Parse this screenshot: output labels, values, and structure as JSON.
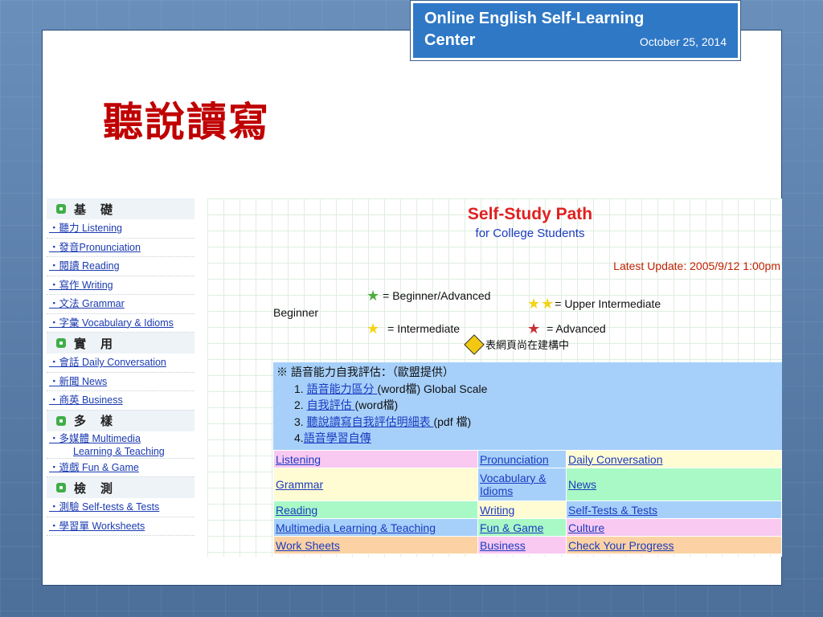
{
  "header": {
    "title": "Online English Self-Learning Center",
    "date": "October 25, 2014"
  },
  "slide_title": "聽說讀寫",
  "nav": {
    "sections": [
      {
        "heading": "基礎",
        "items": [
          {
            "label": "‧聽力 Listening"
          },
          {
            "label": "‧發音Pronunciation"
          },
          {
            "label": "‧閱讀 Reading"
          },
          {
            "label": "‧寫作 Writing"
          },
          {
            "label": "‧文法 Grammar"
          },
          {
            "label": "‧字彙 Vocabulary & Idioms"
          }
        ]
      },
      {
        "heading": "實用",
        "items": [
          {
            "label": "‧會話 Daily Conversation"
          },
          {
            "label": "‧新聞 News"
          },
          {
            "label": "‧商英 Business"
          }
        ]
      },
      {
        "heading": "多樣",
        "items": [
          {
            "label": "‧多媒體 Multimedia",
            "sub": "Learning & Teaching"
          },
          {
            "label": "‧遊戲 Fun & Game"
          }
        ]
      },
      {
        "heading": "檢測",
        "items": [
          {
            "label": "‧測驗 Self-tests & Tests"
          },
          {
            "label": "‧學習單 Worksheets"
          }
        ]
      }
    ]
  },
  "main": {
    "title": "Self-Study Path",
    "subtitle": "for College Students",
    "update": "Latest Update: 2005/9/12 1:00pm",
    "beginner": "Beginner",
    "legend": {
      "beginner_advanced": "= Beginner/Advanced",
      "upper_intermediate": "= Upper Intermediate",
      "intermediate": "= Intermediate",
      "advanced": "= Advanced"
    },
    "construction": "表網頁尚在建構中",
    "eval": {
      "heading": "※ 語音能力自我評估：（歐盟提供）",
      "items": [
        {
          "num": "1.",
          "link": "語音能力區分 ",
          "rest": "(word檔) Global Scale"
        },
        {
          "num": "2.",
          "link": "自我評估 ",
          "rest": "(word檔)"
        },
        {
          "num": "3.",
          "link": "聽說讀寫自我評估明細表 ",
          "rest": "(pdf 檔)"
        },
        {
          "num": "4.",
          "link": "語音學習自傳",
          "rest": ""
        }
      ]
    },
    "grid": [
      [
        "Listening",
        "Pronunciation",
        "Daily Conversation"
      ],
      [
        "Grammar",
        "Vocabulary & Idioms",
        "News"
      ],
      [
        "Reading",
        "Writing",
        "Self-Tests & Tests"
      ],
      [
        "Multimedia Learning & Teaching",
        "Fun & Game",
        "Culture"
      ],
      [
        "Work Sheets",
        "Business",
        "Check Your Progress"
      ]
    ]
  },
  "colors": {
    "title_red": "#c00000",
    "header_blue": "#2f78c6",
    "link_blue": "#1b3bc0"
  }
}
